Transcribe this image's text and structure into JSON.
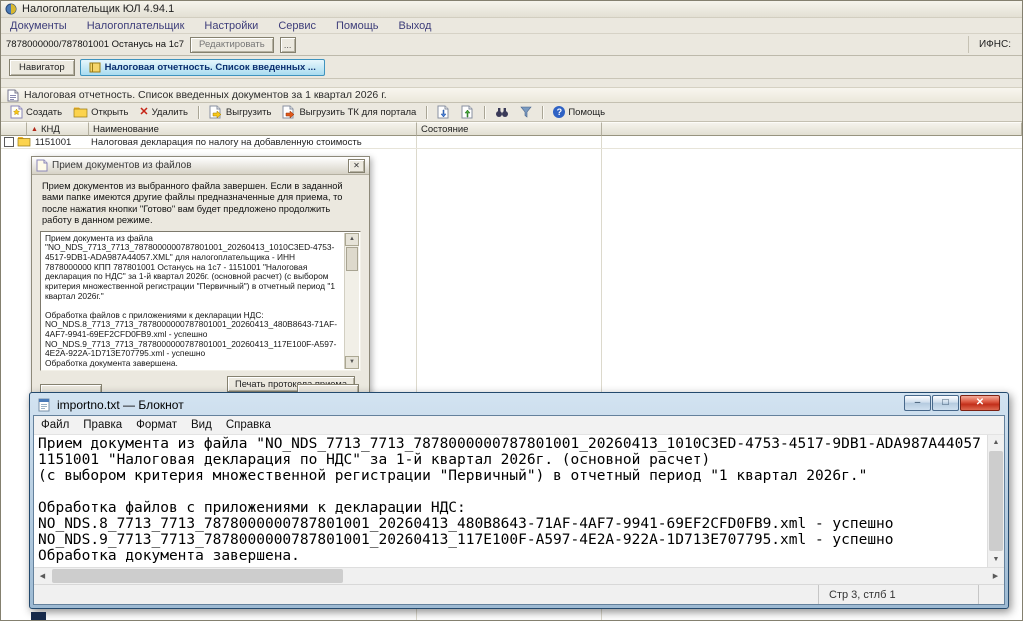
{
  "window": {
    "title": "Налогоплательщик ЮЛ 4.94.1",
    "menu": [
      "Документы",
      "Налогоплательщик",
      "Настройки",
      "Сервис",
      "Помощь",
      "Выход"
    ]
  },
  "orgbar": {
    "org": "7878000000/787801001 Останусь на 1с7",
    "edit_button": "Редактировать",
    "more_button": "...",
    "ifns_label": "ИФНС:"
  },
  "tabs": {
    "navigator_button": "Навигатор",
    "active_tab": "Налоговая отчетность. Список введенных ..."
  },
  "section": {
    "title": "Налоговая отчетность. Список введенных документов за 1 квартал 2026 г."
  },
  "toolbar": {
    "create": "Создать",
    "open": "Открыть",
    "delete": "Удалить",
    "export": "Выгрузить",
    "export_tk": "Выгрузить ТК для портала",
    "help": "Помощь"
  },
  "table": {
    "col_knd": "КНД",
    "col_name": "Наименование",
    "col_state": "Состояние",
    "rows": [
      {
        "knd": "1151001",
        "name": "Налоговая декларация по налогу на добавленную стоимость"
      }
    ]
  },
  "dialog": {
    "title": "Прием документов из файлов",
    "intro": "Прием документов из выбранного файла завершен. Если в заданной вами папке имеются другие файлы предназначенные для приема, то после нажатия кнопки \"Готово\" вам будет предложено продолжить работу в данном режиме.",
    "log": [
      "Прием документа из файла",
      "\"NO_NDS_7713_7713_7878000000787801001_20260413_1010C3ED-4753-4517-9DB1-ADA987A44057.XML\" для налогоплательщика - ИНН 7878000000 КПП 787801001 Останусь на 1с7 - 1151001 \"Налоговая декларация по НДС\" за 1-й квартал 2026г. (основной расчет) (с выбором критерия множественной регистрации \"Первичный\") в отчетный период \"1 квартал 2026г.\"",
      "",
      "Обработка файлов с приложениями к декларации НДС:",
      "NO_NDS.8_7713_7713_7878000000787801001_20260413_480B8643-71AF-4AF7-9941-69EF2CFD0FB9.xml - успешно",
      "NO_NDS.9_7713_7713_7878000000787801001_20260413_117E100F-A597-4E2A-922A-1D713E707795.xml - успешно",
      "Обработка документа завершена."
    ],
    "print_button": "Печать протокола приема"
  },
  "notepad": {
    "title": "importno.txt — Блокнот",
    "menu": [
      "Файл",
      "Правка",
      "Формат",
      "Вид",
      "Справка"
    ],
    "lines": [
      "Прием документа из файла \"NO_NDS_7713_7713_7878000000787801001_20260413_1010C3ED-4753-4517-9DB1-ADA987A44057",
      "1151001 \"Налоговая декларация по НДС\" за 1-й квартал 2026г. (основной расчет)",
      "(с выбором критерия множественной регистрации \"Первичный\") в отчетный период \"1 квартал 2026г.\"",
      "",
      "Обработка файлов с приложениями к декларации НДС:",
      "NO_NDS.8_7713_7713_7878000000787801001_20260413_480B8643-71AF-4AF7-9941-69EF2CFD0FB9.xml - успешно",
      "NO_NDS.9_7713_7713_7878000000787801001_20260413_117E100F-A597-4E2A-922A-1D713E707795.xml - успешно",
      "Обработка документа завершена."
    ],
    "status": "Стр 3, стлб 1"
  },
  "colors": {
    "active_tab_fill": "#a9dcf0",
    "notepad_close_red": "#c22f1a",
    "folder_yellow": "#fcd34d",
    "help_blue": "#2f62c4"
  }
}
